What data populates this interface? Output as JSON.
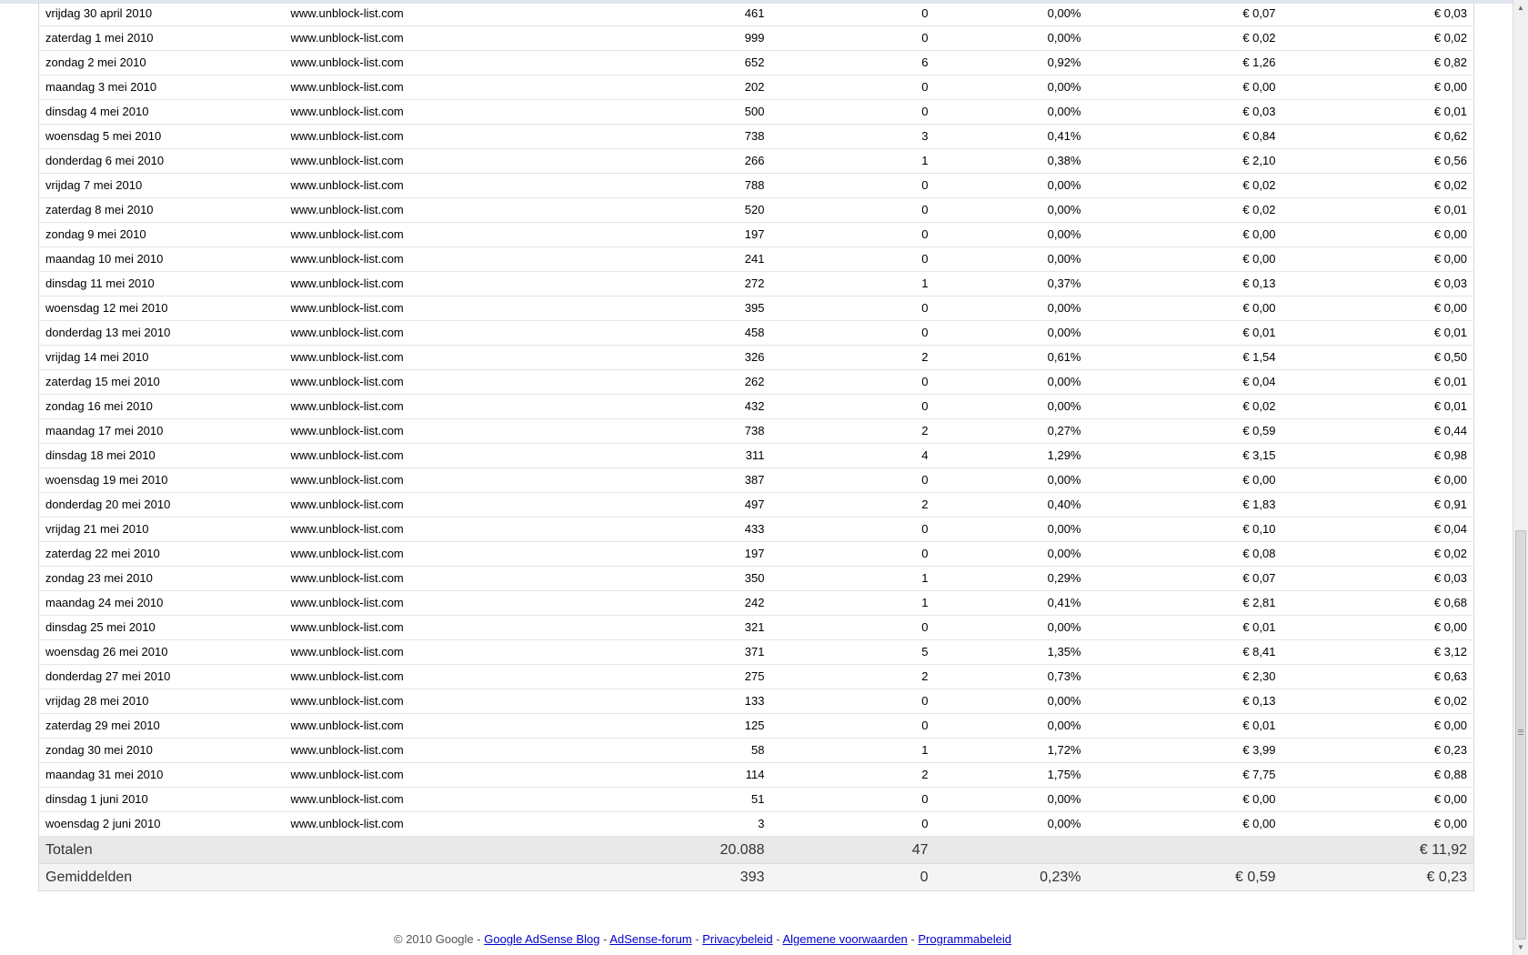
{
  "report": {
    "rows": [
      {
        "date": "vrijdag 30 april 2010",
        "site": "www.unblock-list.com",
        "views": "461",
        "clicks": "0",
        "ctr": "0,00%",
        "ecpm": "€ 0,07",
        "earnings": "€ 0,03"
      },
      {
        "date": "zaterdag 1 mei 2010",
        "site": "www.unblock-list.com",
        "views": "999",
        "clicks": "0",
        "ctr": "0,00%",
        "ecpm": "€ 0,02",
        "earnings": "€ 0,02"
      },
      {
        "date": "zondag 2 mei 2010",
        "site": "www.unblock-list.com",
        "views": "652",
        "clicks": "6",
        "ctr": "0,92%",
        "ecpm": "€ 1,26",
        "earnings": "€ 0,82"
      },
      {
        "date": "maandag 3 mei 2010",
        "site": "www.unblock-list.com",
        "views": "202",
        "clicks": "0",
        "ctr": "0,00%",
        "ecpm": "€ 0,00",
        "earnings": "€ 0,00"
      },
      {
        "date": "dinsdag 4 mei 2010",
        "site": "www.unblock-list.com",
        "views": "500",
        "clicks": "0",
        "ctr": "0,00%",
        "ecpm": "€ 0,03",
        "earnings": "€ 0,01"
      },
      {
        "date": "woensdag 5 mei 2010",
        "site": "www.unblock-list.com",
        "views": "738",
        "clicks": "3",
        "ctr": "0,41%",
        "ecpm": "€ 0,84",
        "earnings": "€ 0,62"
      },
      {
        "date": "donderdag 6 mei 2010",
        "site": "www.unblock-list.com",
        "views": "266",
        "clicks": "1",
        "ctr": "0,38%",
        "ecpm": "€ 2,10",
        "earnings": "€ 0,56"
      },
      {
        "date": "vrijdag 7 mei 2010",
        "site": "www.unblock-list.com",
        "views": "788",
        "clicks": "0",
        "ctr": "0,00%",
        "ecpm": "€ 0,02",
        "earnings": "€ 0,02"
      },
      {
        "date": "zaterdag 8 mei 2010",
        "site": "www.unblock-list.com",
        "views": "520",
        "clicks": "0",
        "ctr": "0,00%",
        "ecpm": "€ 0,02",
        "earnings": "€ 0,01"
      },
      {
        "date": "zondag 9 mei 2010",
        "site": "www.unblock-list.com",
        "views": "197",
        "clicks": "0",
        "ctr": "0,00%",
        "ecpm": "€ 0,00",
        "earnings": "€ 0,00"
      },
      {
        "date": "maandag 10 mei 2010",
        "site": "www.unblock-list.com",
        "views": "241",
        "clicks": "0",
        "ctr": "0,00%",
        "ecpm": "€ 0,00",
        "earnings": "€ 0,00"
      },
      {
        "date": "dinsdag 11 mei 2010",
        "site": "www.unblock-list.com",
        "views": "272",
        "clicks": "1",
        "ctr": "0,37%",
        "ecpm": "€ 0,13",
        "earnings": "€ 0,03"
      },
      {
        "date": "woensdag 12 mei 2010",
        "site": "www.unblock-list.com",
        "views": "395",
        "clicks": "0",
        "ctr": "0,00%",
        "ecpm": "€ 0,00",
        "earnings": "€ 0,00"
      },
      {
        "date": "donderdag 13 mei 2010",
        "site": "www.unblock-list.com",
        "views": "458",
        "clicks": "0",
        "ctr": "0,00%",
        "ecpm": "€ 0,01",
        "earnings": "€ 0,01"
      },
      {
        "date": "vrijdag 14 mei 2010",
        "site": "www.unblock-list.com",
        "views": "326",
        "clicks": "2",
        "ctr": "0,61%",
        "ecpm": "€ 1,54",
        "earnings": "€ 0,50"
      },
      {
        "date": "zaterdag 15 mei 2010",
        "site": "www.unblock-list.com",
        "views": "262",
        "clicks": "0",
        "ctr": "0,00%",
        "ecpm": "€ 0,04",
        "earnings": "€ 0,01"
      },
      {
        "date": "zondag 16 mei 2010",
        "site": "www.unblock-list.com",
        "views": "432",
        "clicks": "0",
        "ctr": "0,00%",
        "ecpm": "€ 0,02",
        "earnings": "€ 0,01"
      },
      {
        "date": "maandag 17 mei 2010",
        "site": "www.unblock-list.com",
        "views": "738",
        "clicks": "2",
        "ctr": "0,27%",
        "ecpm": "€ 0,59",
        "earnings": "€ 0,44"
      },
      {
        "date": "dinsdag 18 mei 2010",
        "site": "www.unblock-list.com",
        "views": "311",
        "clicks": "4",
        "ctr": "1,29%",
        "ecpm": "€ 3,15",
        "earnings": "€ 0,98"
      },
      {
        "date": "woensdag 19 mei 2010",
        "site": "www.unblock-list.com",
        "views": "387",
        "clicks": "0",
        "ctr": "0,00%",
        "ecpm": "€ 0,00",
        "earnings": "€ 0,00"
      },
      {
        "date": "donderdag 20 mei 2010",
        "site": "www.unblock-list.com",
        "views": "497",
        "clicks": "2",
        "ctr": "0,40%",
        "ecpm": "€ 1,83",
        "earnings": "€ 0,91"
      },
      {
        "date": "vrijdag 21 mei 2010",
        "site": "www.unblock-list.com",
        "views": "433",
        "clicks": "0",
        "ctr": "0,00%",
        "ecpm": "€ 0,10",
        "earnings": "€ 0,04"
      },
      {
        "date": "zaterdag 22 mei 2010",
        "site": "www.unblock-list.com",
        "views": "197",
        "clicks": "0",
        "ctr": "0,00%",
        "ecpm": "€ 0,08",
        "earnings": "€ 0,02"
      },
      {
        "date": "zondag 23 mei 2010",
        "site": "www.unblock-list.com",
        "views": "350",
        "clicks": "1",
        "ctr": "0,29%",
        "ecpm": "€ 0,07",
        "earnings": "€ 0,03"
      },
      {
        "date": "maandag 24 mei 2010",
        "site": "www.unblock-list.com",
        "views": "242",
        "clicks": "1",
        "ctr": "0,41%",
        "ecpm": "€ 2,81",
        "earnings": "€ 0,68"
      },
      {
        "date": "dinsdag 25 mei 2010",
        "site": "www.unblock-list.com",
        "views": "321",
        "clicks": "0",
        "ctr": "0,00%",
        "ecpm": "€ 0,01",
        "earnings": "€ 0,00"
      },
      {
        "date": "woensdag 26 mei 2010",
        "site": "www.unblock-list.com",
        "views": "371",
        "clicks": "5",
        "ctr": "1,35%",
        "ecpm": "€ 8,41",
        "earnings": "€ 3,12"
      },
      {
        "date": "donderdag 27 mei 2010",
        "site": "www.unblock-list.com",
        "views": "275",
        "clicks": "2",
        "ctr": "0,73%",
        "ecpm": "€ 2,30",
        "earnings": "€ 0,63"
      },
      {
        "date": "vrijdag 28 mei 2010",
        "site": "www.unblock-list.com",
        "views": "133",
        "clicks": "0",
        "ctr": "0,00%",
        "ecpm": "€ 0,13",
        "earnings": "€ 0,02"
      },
      {
        "date": "zaterdag 29 mei 2010",
        "site": "www.unblock-list.com",
        "views": "125",
        "clicks": "0",
        "ctr": "0,00%",
        "ecpm": "€ 0,01",
        "earnings": "€ 0,00"
      },
      {
        "date": "zondag 30 mei 2010",
        "site": "www.unblock-list.com",
        "views": "58",
        "clicks": "1",
        "ctr": "1,72%",
        "ecpm": "€ 3,99",
        "earnings": "€ 0,23"
      },
      {
        "date": "maandag 31 mei 2010",
        "site": "www.unblock-list.com",
        "views": "114",
        "clicks": "2",
        "ctr": "1,75%",
        "ecpm": "€ 7,75",
        "earnings": "€ 0,88"
      },
      {
        "date": "dinsdag 1 juni 2010",
        "site": "www.unblock-list.com",
        "views": "51",
        "clicks": "0",
        "ctr": "0,00%",
        "ecpm": "€ 0,00",
        "earnings": "€ 0,00"
      },
      {
        "date": "woensdag 2 juni 2010",
        "site": "www.unblock-list.com",
        "views": "3",
        "clicks": "0",
        "ctr": "0,00%",
        "ecpm": "€ 0,00",
        "earnings": "€ 0,00"
      }
    ],
    "totals": {
      "label": "Totalen",
      "views": "20.088",
      "clicks": "47",
      "ctr": "",
      "ecpm": "",
      "earnings": "€ 11,92"
    },
    "averages": {
      "label": "Gemiddelden",
      "views": "393",
      "clicks": "0",
      "ctr": "0,23%",
      "ecpm": "€ 0,59",
      "earnings": "€ 0,23"
    }
  },
  "footer": {
    "copyright": "© 2010 Google",
    "separator": "-",
    "links": [
      "Google AdSense Blog",
      "AdSense-forum",
      "Privacybeleid",
      "Algemene voorwaarden",
      "Programmabeleid"
    ]
  },
  "scrollbar": {
    "position": 0.97,
    "up_icon": "scroll-up-arrow-icon",
    "down_icon": "scroll-down-arrow-icon"
  },
  "colors": {
    "link": "#0000cc",
    "totals_background": "#e9e9e9",
    "averages_background": "#f4f4f4"
  }
}
